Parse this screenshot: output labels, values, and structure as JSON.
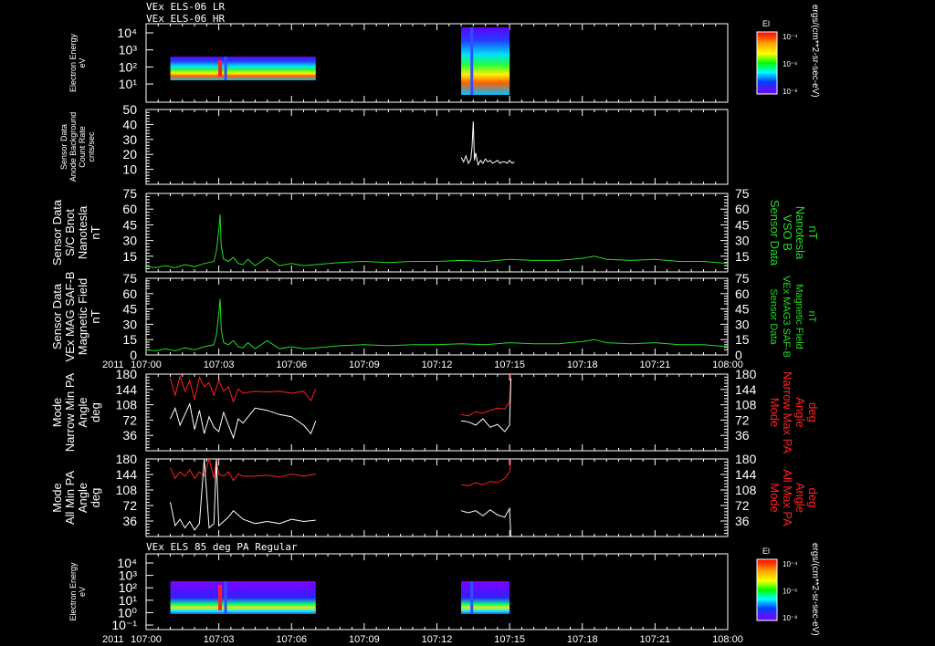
{
  "header": {
    "line1": "VEx ELS-06 LR",
    "line2": "VEx ELS-06 HR",
    "bottom_title": "VEx ELS 85 deg PA Regular"
  },
  "xaxis": {
    "year": "2011",
    "ticks": [
      "107:00",
      "107:03",
      "107:06",
      "107:09",
      "107:12",
      "107:15",
      "107:18",
      "107:21",
      "108:00"
    ]
  },
  "colorbar": {
    "title": "El",
    "unit": "ergs/(cm**2-sr-sec-eV)",
    "labels": [
      "10⁻⁴",
      "10⁻⁶",
      "10⁻⁸"
    ]
  },
  "colors": {
    "white": "#ffffff",
    "green": "#22dd22",
    "red": "#ff2020"
  },
  "chart_data": [
    {
      "type": "heatmap",
      "panel": "electron-energy-top",
      "ylabel": [
        "Electron Energy",
        "eV"
      ],
      "yticks": [
        "10⁴",
        "10³",
        "10²",
        "10¹"
      ],
      "blocks": [
        {
          "x_start": "107:01",
          "x_end": "107:07",
          "e_min": 10,
          "e_max": 200
        },
        {
          "x_start": "107:13",
          "x_end": "107:15",
          "e_min": 10,
          "e_max": 10000
        }
      ]
    },
    {
      "type": "line",
      "panel": "anode-background",
      "ylabel": [
        "Sensor Data",
        "Anode Background",
        "Count Rate",
        "cnts/sec"
      ],
      "yticks": [
        "50",
        "40",
        "30",
        "20",
        "10"
      ],
      "ylim": [
        0,
        50
      ],
      "series": [
        {
          "color": "white",
          "x": [
            13.0,
            13.1,
            13.2,
            13.3,
            13.4,
            13.45,
            13.5,
            13.55,
            13.6,
            13.7,
            13.8,
            13.9,
            14.0,
            14.1,
            14.2,
            14.3,
            14.4,
            14.5,
            14.6,
            14.7,
            14.8,
            14.9,
            15.0,
            15.1,
            15.2
          ],
          "y": [
            18,
            15,
            19,
            14,
            17,
            25,
            42,
            16,
            21,
            13,
            16,
            14,
            17,
            15,
            16,
            14,
            15,
            16,
            14,
            15,
            15,
            14,
            16,
            14,
            15
          ]
        }
      ]
    },
    {
      "type": "line",
      "panel": "sc-bnot",
      "ylabel": [
        "Sensor Data",
        "S/C Bnot",
        "Nanotesla",
        "nT"
      ],
      "right_label": [
        "Sensor Data",
        "VSO B",
        "Nanotesla",
        "nT"
      ],
      "yticks": [
        "75",
        "60",
        "45",
        "30",
        "15"
      ],
      "ylim": [
        0,
        75
      ],
      "series": [
        {
          "color": "green",
          "x": [
            0,
            0.4,
            0.8,
            1.2,
            1.6,
            2.0,
            2.4,
            2.8,
            2.9,
            3.0,
            3.05,
            3.1,
            3.2,
            3.4,
            3.6,
            3.8,
            4.0,
            4.2,
            4.5,
            5.0,
            5.5,
            6.0,
            6.5,
            7.0,
            8,
            9,
            10,
            11,
            12,
            13,
            14,
            15,
            16,
            17,
            18,
            18.5,
            19,
            20,
            21,
            22,
            23,
            24
          ],
          "y": [
            5,
            4,
            6,
            4,
            7,
            5,
            8,
            10,
            20,
            40,
            55,
            25,
            12,
            10,
            14,
            8,
            7,
            12,
            6,
            14,
            6,
            8,
            6,
            7,
            9,
            10,
            9,
            10,
            10,
            11,
            10,
            12,
            11,
            11,
            13,
            15,
            12,
            11,
            12,
            10,
            10,
            8
          ]
        }
      ]
    },
    {
      "type": "line",
      "panel": "mag-saf-b",
      "ylabel": [
        "Sensor Data",
        "VEx MAG SAF-B",
        "Magnetic Field",
        "nT"
      ],
      "right_label": [
        "Sensor Data",
        "VEx MAG3 SAF-B",
        "Magnetic Field",
        "nT"
      ],
      "yticks": [
        "75",
        "60",
        "45",
        "30",
        "15",
        "0"
      ],
      "ylim": [
        0,
        75
      ],
      "series": [
        {
          "color": "green",
          "x": [
            0,
            0.4,
            0.8,
            1.2,
            1.6,
            2.0,
            2.4,
            2.8,
            2.9,
            3.0,
            3.05,
            3.1,
            3.2,
            3.4,
            3.6,
            3.8,
            4.0,
            4.2,
            4.5,
            5.0,
            5.5,
            6.0,
            6.5,
            7.0,
            8,
            9,
            10,
            11,
            12,
            13,
            14,
            15,
            16,
            17,
            18,
            18.5,
            19,
            20,
            21,
            22,
            23,
            24
          ],
          "y": [
            5,
            4,
            6,
            4,
            7,
            5,
            8,
            10,
            20,
            40,
            55,
            25,
            12,
            10,
            14,
            8,
            7,
            12,
            6,
            14,
            6,
            8,
            6,
            7,
            9,
            10,
            9,
            10,
            10,
            11,
            10,
            12,
            11,
            11,
            13,
            15,
            12,
            11,
            12,
            10,
            10,
            8
          ]
        }
      ]
    },
    {
      "type": "line",
      "panel": "narrow-pa",
      "ylabel": [
        "Mode",
        "Narrow Min PA",
        "Angle",
        "deg"
      ],
      "right_label": [
        "Mode",
        "Narrow Max PA",
        "Angle",
        "deg"
      ],
      "yticks": [
        "180",
        "144",
        "108",
        "72",
        "36"
      ],
      "ylim": [
        0,
        180
      ],
      "series": [
        {
          "color": "red",
          "segments": [
            {
              "x": [
                1.0,
                1.2,
                1.4,
                1.6,
                1.8,
                2.0,
                2.2,
                2.4,
                2.6,
                2.8,
                3.0,
                3.2,
                3.4,
                3.6,
                3.8,
                4.0,
                4.5,
                5.0,
                5.5,
                6.0,
                6.5,
                6.8,
                7.0
              ],
              "y": [
                170,
                130,
                175,
                140,
                165,
                120,
                172,
                150,
                160,
                130,
                165,
                140,
                150,
                115,
                145,
                135,
                140,
                138,
                140,
                135,
                140,
                118,
                145
              ]
            },
            {
              "x": [
                13.0,
                13.3,
                13.6,
                13.9,
                14.2,
                14.5,
                14.8,
                15.0,
                15.05
              ],
              "y": [
                85,
                82,
                92,
                88,
                95,
                100,
                98,
                115,
                180
              ]
            }
          ]
        },
        {
          "color": "white",
          "segments": [
            {
              "x": [
                1.0,
                1.2,
                1.4,
                1.6,
                1.8,
                2.0,
                2.2,
                2.4,
                2.6,
                2.8,
                3.0,
                3.2,
                3.4,
                3.6,
                3.8,
                4.0,
                4.5,
                5.0,
                5.5,
                6.0,
                6.5,
                6.8,
                7.0
              ],
              "y": [
                75,
                100,
                60,
                85,
                110,
                50,
                95,
                40,
                80,
                55,
                45,
                90,
                60,
                30,
                75,
                65,
                100,
                95,
                85,
                80,
                60,
                40,
                70
              ]
            },
            {
              "x": [
                13.0,
                13.3,
                13.6,
                13.9,
                14.2,
                14.5,
                14.8,
                15.0,
                15.05
              ],
              "y": [
                70,
                68,
                60,
                75,
                55,
                62,
                45,
                60,
                170
              ]
            }
          ]
        }
      ]
    },
    {
      "type": "line",
      "panel": "all-pa",
      "ylabel": [
        "Mode",
        "All Min PA",
        "Angle",
        "deg"
      ],
      "right_label": [
        "Mode",
        "All Max PA",
        "Angle",
        "deg"
      ],
      "yticks": [
        "180",
        "144",
        "108",
        "72",
        "36"
      ],
      "ylim": [
        0,
        180
      ],
      "series": [
        {
          "color": "red",
          "segments": [
            {
              "x": [
                1.0,
                1.2,
                1.4,
                1.6,
                1.8,
                2.0,
                2.2,
                2.4,
                2.6,
                2.8,
                2.9,
                3.0,
                3.2,
                3.4,
                3.6,
                3.8,
                4.0,
                4.5,
                5.0,
                5.5,
                6.0,
                6.5,
                7.0
              ],
              "y": [
                160,
                135,
                150,
                140,
                155,
                135,
                150,
                140,
                180,
                135,
                180,
                145,
                140,
                150,
                130,
                145,
                140,
                140,
                142,
                138,
                145,
                140,
                145
              ]
            },
            {
              "x": [
                13.0,
                13.3,
                13.6,
                13.9,
                14.2,
                14.5,
                14.8,
                15.0,
                15.05
              ],
              "y": [
                120,
                118,
                125,
                120,
                128,
                125,
                135,
                150,
                180
              ]
            }
          ]
        },
        {
          "color": "white",
          "segments": [
            {
              "x": [
                1.0,
                1.2,
                1.4,
                1.6,
                1.8,
                2.0,
                2.2,
                2.4,
                2.6,
                2.8,
                2.9,
                3.0,
                3.2,
                3.4,
                3.6,
                3.8,
                4.0,
                4.5,
                5.0,
                5.5,
                6.0,
                6.5,
                7.0
              ],
              "y": [
                80,
                25,
                40,
                20,
                35,
                15,
                30,
                180,
                20,
                30,
                180,
                25,
                35,
                45,
                60,
                50,
                40,
                30,
                35,
                30,
                40,
                35,
                38
              ]
            },
            {
              "x": [
                13.0,
                13.3,
                13.6,
                13.9,
                14.2,
                14.5,
                14.8,
                15.0,
                15.05
              ],
              "y": [
                60,
                55,
                60,
                48,
                62,
                50,
                45,
                65,
                0
              ]
            }
          ]
        }
      ]
    },
    {
      "type": "heatmap",
      "panel": "electron-energy-85deg",
      "ylabel": [
        "Electron Energy",
        "eV"
      ],
      "yticks": [
        "10⁴",
        "10³",
        "10²",
        "10¹",
        "10⁰",
        "10⁻¹"
      ],
      "blocks": [
        {
          "x_start": "107:01",
          "x_end": "107:07",
          "e_min": 5,
          "e_max": 200
        },
        {
          "x_start": "107:13",
          "x_end": "107:15",
          "e_min": 0.3,
          "e_max": 200
        }
      ]
    }
  ]
}
